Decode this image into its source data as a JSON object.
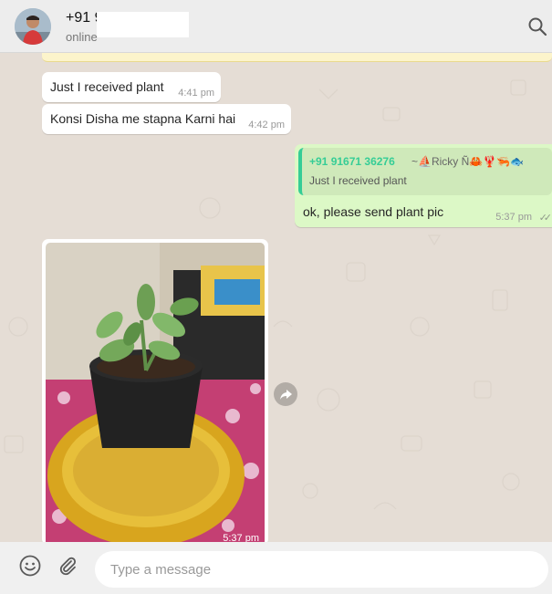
{
  "header": {
    "contact_name": "+91 9",
    "status": "online",
    "avatar_icon": "avatar-person-icon",
    "search_icon": "search-icon"
  },
  "messages": [
    {
      "direction": "in",
      "text": "Just I received plant",
      "time": "4:41 pm"
    },
    {
      "direction": "in",
      "text": "Konsi Disha me stapna Karni hai",
      "time": "4:42 pm"
    },
    {
      "direction": "out",
      "quote": {
        "sender": "+91 91671 36276",
        "author": "~⛵Ricky Ñ🦀🦞🦐🐟",
        "text": "Just I received plant"
      },
      "text": "ok, please send plant pic",
      "time": "5:37 pm",
      "ticks": "✓✓"
    },
    {
      "direction": "in",
      "type": "image",
      "time": "5:37 pm"
    }
  ],
  "footer": {
    "placeholder": "Type a message",
    "emoji_icon": "smiley-icon",
    "attach_icon": "paperclip-icon"
  },
  "colors": {
    "header_bg": "#ededed",
    "chat_bg": "#e5ddd5",
    "incoming_bubble": "#ffffff",
    "outgoing_bubble": "#dcf8c6",
    "quote_accent": "#35cd96",
    "footer_bg": "#f0f0f0"
  }
}
